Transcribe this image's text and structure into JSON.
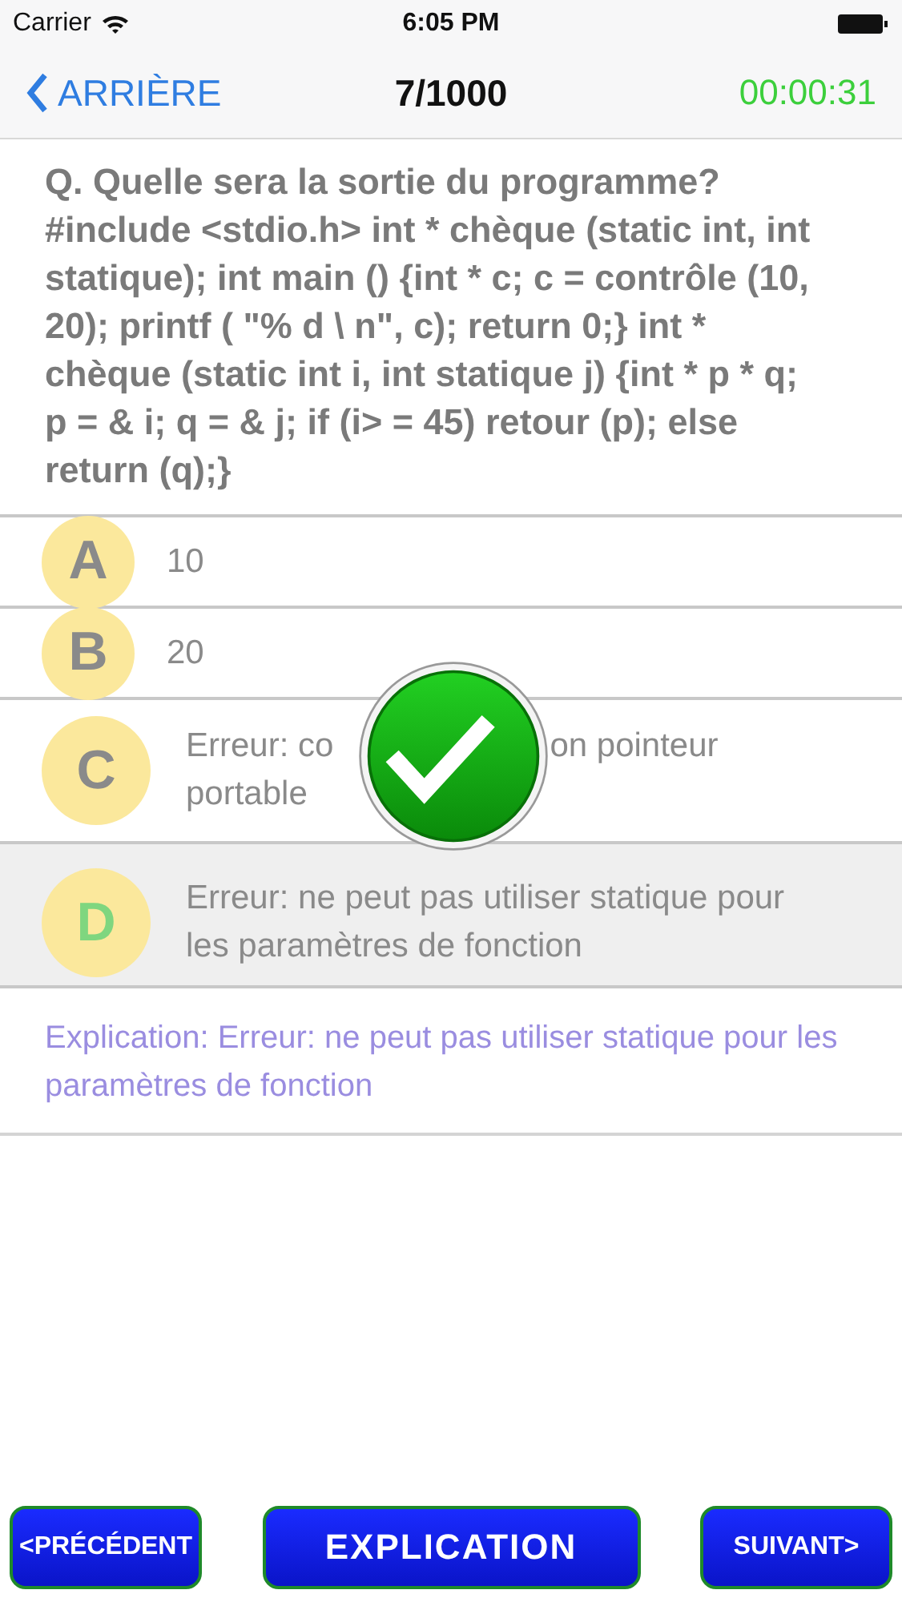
{
  "status_bar": {
    "carrier": "Carrier",
    "time": "6:05 PM"
  },
  "nav": {
    "back": "ARRIÈRE",
    "title": "7/1000",
    "timer": "00:00:31"
  },
  "question": "Q. Quelle sera la sortie du programme? #include <stdio.h> int * chèque (static int, int statique); int main () {int * c; c = contrôle (10, 20); printf ( \"% d \\ n\", c); return 0;} int * chèque (static int i, int statique j) {int * p * q; p = & i; q = & j; if (i> = 45) retour (p); else return (q);}",
  "options": [
    {
      "letter": "A",
      "text": "10",
      "selected": false,
      "correct": false
    },
    {
      "letter": "B",
      "text": "20",
      "selected": false,
      "correct": false
    },
    {
      "letter": "C",
      "text": "Erreur: co",
      "text_after_overlay": "on pointeur",
      "text_line_2": "portable",
      "selected": false,
      "correct": false
    },
    {
      "letter": "D",
      "text": "Erreur: ne peut pas utiliser statique pour les paramètres de fonction",
      "selected": true,
      "correct": true
    }
  ],
  "check_overlay_shown": true,
  "explanation": "Explication: Erreur: ne peut pas utiliser statique pour les paramètres de fonction",
  "buttons": {
    "previous": "<PRÉCÉDENT",
    "explain": "EXPLICATION",
    "next": "SUIVANT>"
  }
}
